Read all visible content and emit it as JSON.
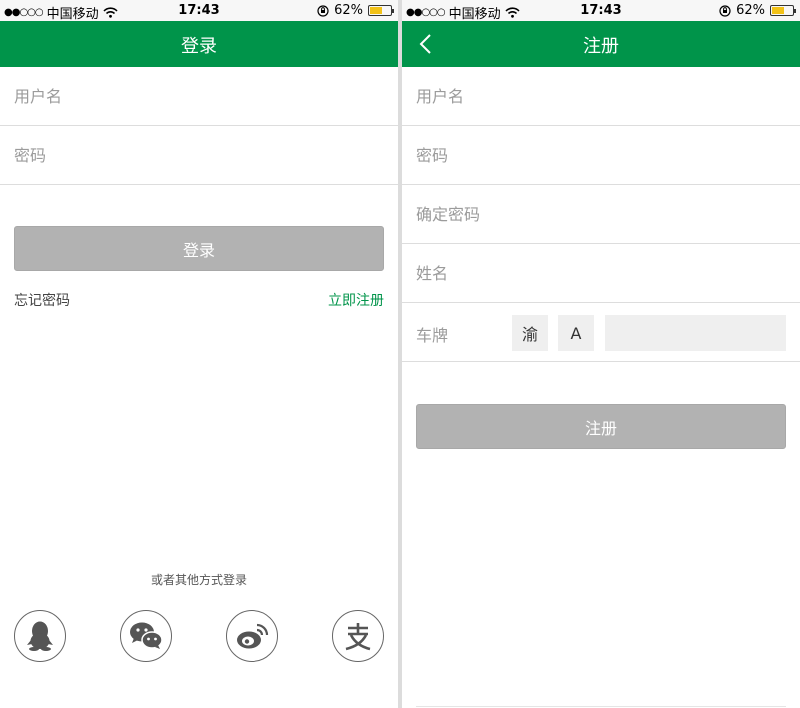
{
  "status_bar": {
    "signal": "●●○○○",
    "carrier": "中国移动",
    "time": "17:43",
    "battery_percent": "62%",
    "battery_level": 0.62,
    "wifi_icon": "wifi-icon",
    "rotation_lock_icon": "rotation-lock-icon"
  },
  "login": {
    "title": "登录",
    "username_placeholder": "用户名",
    "password_placeholder": "密码",
    "login_button": "登录",
    "forgot_password": "忘记密码",
    "register_now": "立即注册",
    "other_methods": "或者其他方式登录",
    "social_icons": [
      "qq-icon",
      "wechat-icon",
      "weibo-icon",
      "alipay-icon"
    ]
  },
  "register": {
    "title": "注册",
    "username_placeholder": "用户名",
    "password_placeholder": "密码",
    "confirm_password_placeholder": "确定密码",
    "name_placeholder": "姓名",
    "plate_label": "车牌",
    "plate_province": "渝",
    "plate_letter": "A",
    "plate_number": "",
    "register_button": "注册"
  },
  "colors": {
    "brand_green": "#00944a",
    "button_disabled": "#b2b2b2",
    "divider": "#dddddd"
  }
}
